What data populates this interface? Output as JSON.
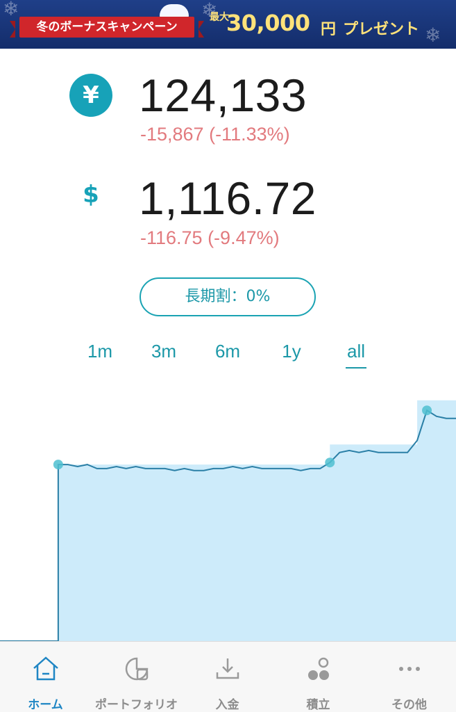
{
  "banner": {
    "campaign": "冬のボーナスキャンペーン",
    "pre": "最大",
    "amount": "30,000",
    "unit": "円",
    "post": "プレゼント"
  },
  "balances": {
    "jpy": {
      "symbol": "¥",
      "amount": "124,133",
      "change": "-15,867 (-11.33%)"
    },
    "usd": {
      "symbol": "$",
      "amount": "1,116.72",
      "change": "-116.75 (-9.47%)"
    }
  },
  "discount_button": {
    "label": "長期割：0%"
  },
  "range_tabs": [
    {
      "label": "1m",
      "active": false
    },
    {
      "label": "3m",
      "active": false
    },
    {
      "label": "6m",
      "active": false
    },
    {
      "label": "1y",
      "active": false
    },
    {
      "label": "all",
      "active": true
    }
  ],
  "colors": {
    "accent": "#17a2b8",
    "negative": "#e27a7e",
    "chart_fill": "#cdebfa",
    "chart_line": "#2a7fa6",
    "nav_active": "#1f86c4"
  },
  "chart_data": {
    "type": "line",
    "title": "",
    "xlabel": "",
    "ylabel": "",
    "note": "portfolio value line over deposit (invested amount) area; no axis labels shown",
    "series": [
      {
        "values": [
          0,
          0,
          0,
          0,
          0,
          0,
          0.88,
          0.88,
          0.87,
          0.88,
          0.86,
          0.86,
          0.87,
          0.86,
          0.87,
          0.86,
          0.86,
          0.86,
          0.85,
          0.86,
          0.85,
          0.85,
          0.86,
          0.86,
          0.87,
          0.86,
          0.87,
          0.86,
          0.86,
          0.86,
          0.86,
          0.85,
          0.86,
          0.86,
          0.89,
          0.94,
          0.95,
          0.94,
          0.95,
          0.94,
          0.94,
          0.94,
          0.94,
          1.0,
          1.15,
          1.12,
          1.11,
          1.11
        ]
      }
    ],
    "deposits": [
      0,
      0,
      0,
      0,
      0,
      0,
      0.88,
      0.88,
      0.88,
      0.88,
      0.88,
      0.88,
      0.88,
      0.88,
      0.88,
      0.88,
      0.88,
      0.88,
      0.88,
      0.88,
      0.88,
      0.88,
      0.88,
      0.88,
      0.88,
      0.88,
      0.88,
      0.88,
      0.88,
      0.88,
      0.88,
      0.88,
      0.88,
      0.88,
      0.98,
      0.98,
      0.98,
      0.98,
      0.98,
      0.98,
      0.98,
      0.98,
      0.98,
      1.2,
      1.2,
      1.2,
      1.2,
      1.2
    ],
    "markers": [
      6,
      34,
      44
    ]
  },
  "bottom_nav": [
    {
      "label": "ホーム",
      "icon": "home-icon",
      "active": true
    },
    {
      "label": "ポートフォリオ",
      "icon": "portfolio-icon",
      "active": false
    },
    {
      "label": "入金",
      "icon": "deposit-icon",
      "active": false
    },
    {
      "label": "積立",
      "icon": "accumulate-icon",
      "active": false
    },
    {
      "label": "その他",
      "icon": "more-icon",
      "active": false
    }
  ]
}
